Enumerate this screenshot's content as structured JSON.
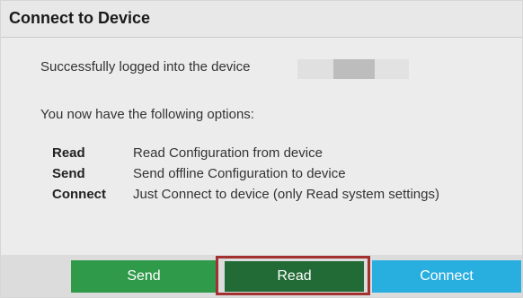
{
  "dialog": {
    "title": "Connect to Device",
    "status_message": "Successfully logged into the device",
    "options_intro": "You now have the following options:",
    "options": [
      {
        "key": "Read",
        "description": "Read Configuration from device"
      },
      {
        "key": "Send",
        "description": "Send offline Configuration to device"
      },
      {
        "key": "Connect",
        "description": "Just Connect to device (only Read system settings)"
      }
    ]
  },
  "buttons": {
    "send_label": "Send",
    "read_label": "Read",
    "connect_label": "Connect"
  },
  "colors": {
    "send": "#2f9a4a",
    "read": "#226b36",
    "connect": "#29aee0",
    "highlight_outline": "#a2312f"
  }
}
